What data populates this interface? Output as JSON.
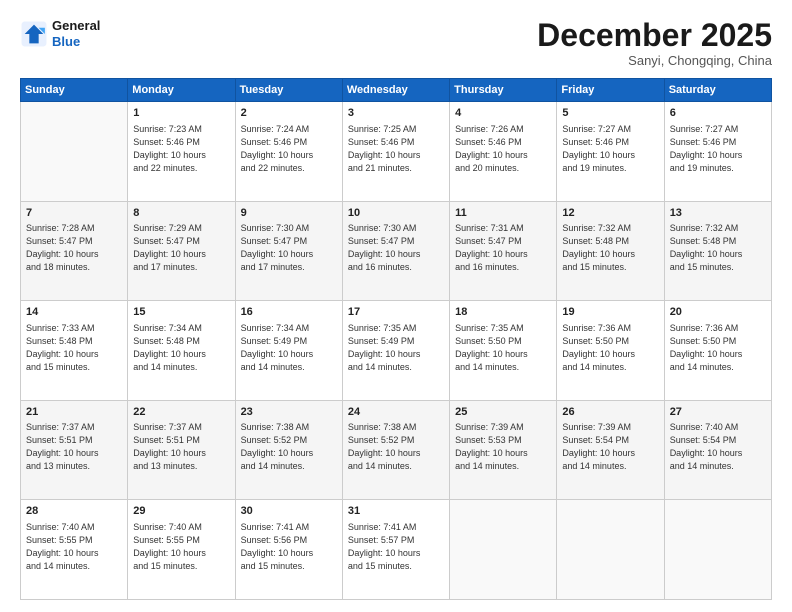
{
  "header": {
    "logo_line1": "General",
    "logo_line2": "Blue",
    "month": "December 2025",
    "location": "Sanyi, Chongqing, China"
  },
  "weekdays": [
    "Sunday",
    "Monday",
    "Tuesday",
    "Wednesday",
    "Thursday",
    "Friday",
    "Saturday"
  ],
  "weeks": [
    [
      {
        "day": "",
        "info": ""
      },
      {
        "day": "1",
        "info": "Sunrise: 7:23 AM\nSunset: 5:46 PM\nDaylight: 10 hours\nand 22 minutes."
      },
      {
        "day": "2",
        "info": "Sunrise: 7:24 AM\nSunset: 5:46 PM\nDaylight: 10 hours\nand 22 minutes."
      },
      {
        "day": "3",
        "info": "Sunrise: 7:25 AM\nSunset: 5:46 PM\nDaylight: 10 hours\nand 21 minutes."
      },
      {
        "day": "4",
        "info": "Sunrise: 7:26 AM\nSunset: 5:46 PM\nDaylight: 10 hours\nand 20 minutes."
      },
      {
        "day": "5",
        "info": "Sunrise: 7:27 AM\nSunset: 5:46 PM\nDaylight: 10 hours\nand 19 minutes."
      },
      {
        "day": "6",
        "info": "Sunrise: 7:27 AM\nSunset: 5:46 PM\nDaylight: 10 hours\nand 19 minutes."
      }
    ],
    [
      {
        "day": "7",
        "info": "Sunrise: 7:28 AM\nSunset: 5:47 PM\nDaylight: 10 hours\nand 18 minutes."
      },
      {
        "day": "8",
        "info": "Sunrise: 7:29 AM\nSunset: 5:47 PM\nDaylight: 10 hours\nand 17 minutes."
      },
      {
        "day": "9",
        "info": "Sunrise: 7:30 AM\nSunset: 5:47 PM\nDaylight: 10 hours\nand 17 minutes."
      },
      {
        "day": "10",
        "info": "Sunrise: 7:30 AM\nSunset: 5:47 PM\nDaylight: 10 hours\nand 16 minutes."
      },
      {
        "day": "11",
        "info": "Sunrise: 7:31 AM\nSunset: 5:47 PM\nDaylight: 10 hours\nand 16 minutes."
      },
      {
        "day": "12",
        "info": "Sunrise: 7:32 AM\nSunset: 5:48 PM\nDaylight: 10 hours\nand 15 minutes."
      },
      {
        "day": "13",
        "info": "Sunrise: 7:32 AM\nSunset: 5:48 PM\nDaylight: 10 hours\nand 15 minutes."
      }
    ],
    [
      {
        "day": "14",
        "info": "Sunrise: 7:33 AM\nSunset: 5:48 PM\nDaylight: 10 hours\nand 15 minutes."
      },
      {
        "day": "15",
        "info": "Sunrise: 7:34 AM\nSunset: 5:48 PM\nDaylight: 10 hours\nand 14 minutes."
      },
      {
        "day": "16",
        "info": "Sunrise: 7:34 AM\nSunset: 5:49 PM\nDaylight: 10 hours\nand 14 minutes."
      },
      {
        "day": "17",
        "info": "Sunrise: 7:35 AM\nSunset: 5:49 PM\nDaylight: 10 hours\nand 14 minutes."
      },
      {
        "day": "18",
        "info": "Sunrise: 7:35 AM\nSunset: 5:50 PM\nDaylight: 10 hours\nand 14 minutes."
      },
      {
        "day": "19",
        "info": "Sunrise: 7:36 AM\nSunset: 5:50 PM\nDaylight: 10 hours\nand 14 minutes."
      },
      {
        "day": "20",
        "info": "Sunrise: 7:36 AM\nSunset: 5:50 PM\nDaylight: 10 hours\nand 14 minutes."
      }
    ],
    [
      {
        "day": "21",
        "info": "Sunrise: 7:37 AM\nSunset: 5:51 PM\nDaylight: 10 hours\nand 13 minutes."
      },
      {
        "day": "22",
        "info": "Sunrise: 7:37 AM\nSunset: 5:51 PM\nDaylight: 10 hours\nand 13 minutes."
      },
      {
        "day": "23",
        "info": "Sunrise: 7:38 AM\nSunset: 5:52 PM\nDaylight: 10 hours\nand 14 minutes."
      },
      {
        "day": "24",
        "info": "Sunrise: 7:38 AM\nSunset: 5:52 PM\nDaylight: 10 hours\nand 14 minutes."
      },
      {
        "day": "25",
        "info": "Sunrise: 7:39 AM\nSunset: 5:53 PM\nDaylight: 10 hours\nand 14 minutes."
      },
      {
        "day": "26",
        "info": "Sunrise: 7:39 AM\nSunset: 5:54 PM\nDaylight: 10 hours\nand 14 minutes."
      },
      {
        "day": "27",
        "info": "Sunrise: 7:40 AM\nSunset: 5:54 PM\nDaylight: 10 hours\nand 14 minutes."
      }
    ],
    [
      {
        "day": "28",
        "info": "Sunrise: 7:40 AM\nSunset: 5:55 PM\nDaylight: 10 hours\nand 14 minutes."
      },
      {
        "day": "29",
        "info": "Sunrise: 7:40 AM\nSunset: 5:55 PM\nDaylight: 10 hours\nand 15 minutes."
      },
      {
        "day": "30",
        "info": "Sunrise: 7:41 AM\nSunset: 5:56 PM\nDaylight: 10 hours\nand 15 minutes."
      },
      {
        "day": "31",
        "info": "Sunrise: 7:41 AM\nSunset: 5:57 PM\nDaylight: 10 hours\nand 15 minutes."
      },
      {
        "day": "",
        "info": ""
      },
      {
        "day": "",
        "info": ""
      },
      {
        "day": "",
        "info": ""
      }
    ]
  ]
}
